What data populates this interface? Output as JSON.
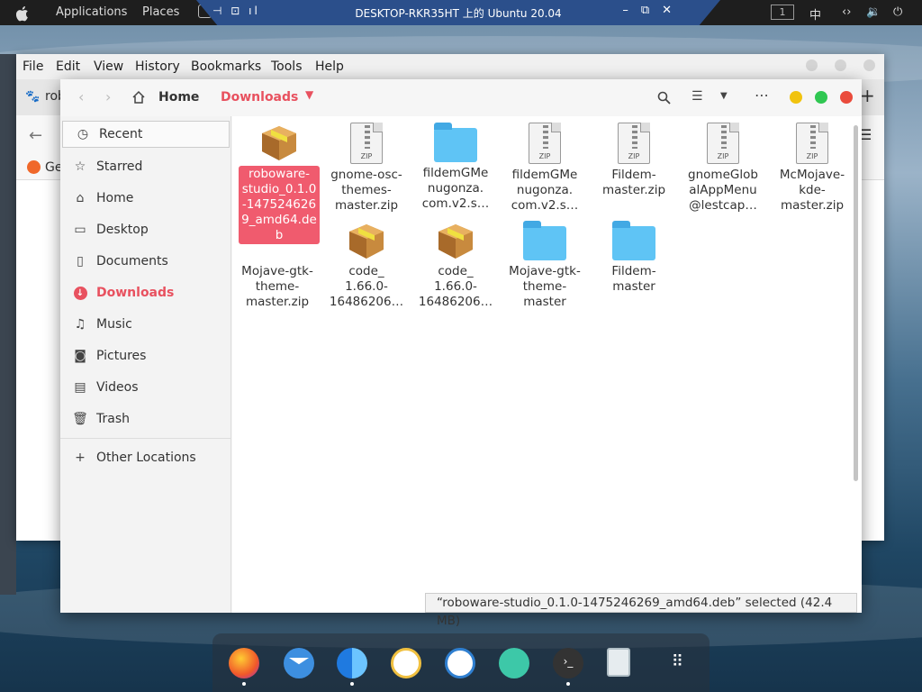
{
  "topbar": {
    "applications": "Applications",
    "places": "Places",
    "vm_title": "DESKTOP-RKR35HT 上的 Ubuntu 20.04",
    "workspace": "1",
    "input_method": "中"
  },
  "firefox": {
    "menu": [
      "File",
      "Edit",
      "View",
      "History",
      "Bookmarks",
      "Tools",
      "Help"
    ],
    "tab_label": "rob",
    "bookmark_label": "Ge"
  },
  "nautilus": {
    "breadcrumb_home": "Home",
    "breadcrumb_current": "Downloads",
    "colors": {
      "accent": "#e8515f",
      "folder": "#5fc4f5"
    },
    "sidebar": [
      {
        "label": "Recent",
        "icon": "clock-icon"
      },
      {
        "label": "Starred",
        "icon": "star-icon"
      },
      {
        "label": "Home",
        "icon": "home-icon"
      },
      {
        "label": "Desktop",
        "icon": "desktop-icon"
      },
      {
        "label": "Documents",
        "icon": "document-icon"
      },
      {
        "label": "Downloads",
        "icon": "download-icon"
      },
      {
        "label": "Music",
        "icon": "music-icon"
      },
      {
        "label": "Pictures",
        "icon": "camera-icon"
      },
      {
        "label": "Videos",
        "icon": "film-icon"
      },
      {
        "label": "Trash",
        "icon": "trash-icon"
      }
    ],
    "other_locations": "Other Locations",
    "files": [
      {
        "name": "roboware-studio_0.1.0-1475246269_amd64.deb",
        "display": "roboware-studio_0.1.0-1475246269_amd64.deb",
        "type": "package",
        "selected": true
      },
      {
        "name": "gnome-osc-themes-master.zip",
        "display": "gnome-osc-themes-master.zip",
        "type": "zip"
      },
      {
        "name": "fildemGMenugonza.com.v2.s",
        "display": "fildemGMe nugonza. com.v2.s…",
        "type": "folder"
      },
      {
        "name": "fildemGMenugonza.com.v2.s zip",
        "display": "fildemGMe nugonza. com.v2.s…",
        "type": "zip"
      },
      {
        "name": "Fildem-master.zip",
        "display": "Fildem-master.zip",
        "type": "zip"
      },
      {
        "name": "gnomeGlobalAppMenu@lestcap",
        "display": "gnomeGlob alAppMenu @lestcap…",
        "type": "zip"
      },
      {
        "name": "McMojave-kde-master.zip",
        "display": "McMojave-kde-master.zip",
        "type": "zip"
      },
      {
        "name": "Mojave-gtk-theme-master.zip",
        "display": "Mojave-gtk-theme-master.zip",
        "type": "zip"
      },
      {
        "name": "code_1.66.0-16486206",
        "display": "code_ 1.66.0- 16486206…",
        "type": "package"
      },
      {
        "name": "code_1.66.0-16486206 b",
        "display": "code_ 1.66.0- 16486206…",
        "type": "package"
      },
      {
        "name": "Mojave-gtk-theme-master",
        "display": "Mojave-gtk-theme-master",
        "type": "folder"
      },
      {
        "name": "Fildem-master",
        "display": "Fildem-master",
        "type": "folder"
      }
    ],
    "status": "“roboware-studio_0.1.0-1475246269_amd64.deb” selected  (42.4 MB)"
  },
  "dock": [
    {
      "name": "firefox-icon",
      "color": "#f0582a",
      "running": true
    },
    {
      "name": "mail-icon",
      "color": "#3d8fe0",
      "running": false
    },
    {
      "name": "finder-icon",
      "color": "#2a8ae6",
      "running": true
    },
    {
      "name": "media-player-icon",
      "color": "#f0c040",
      "running": false
    },
    {
      "name": "text-editor-icon",
      "color": "#2f7fd0",
      "running": false
    },
    {
      "name": "network-icon",
      "color": "#3dc8a8",
      "running": false
    },
    {
      "name": "terminal-icon",
      "color": "#333333",
      "running": true
    },
    {
      "name": "trash-icon",
      "color": "#cfd8dc",
      "running": false
    },
    {
      "name": "app-grid-icon",
      "color": "#ffffff",
      "running": false
    }
  ]
}
